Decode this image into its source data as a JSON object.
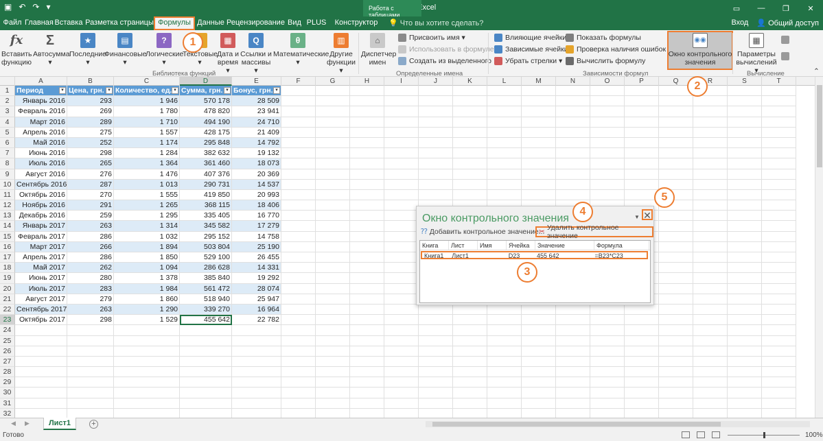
{
  "window": {
    "title": "Книга1 - Excel",
    "context_tab": "Работа с таблицами",
    "tell_me": "Что вы хотите сделать?",
    "signin": "Вход",
    "share": "Общий доступ"
  },
  "tabs": [
    "Файл",
    "Главная",
    "Вставка",
    "Разметка страницы",
    "Формулы",
    "Данные",
    "Рецензирование",
    "Вид",
    "PLUS",
    "Конструктор"
  ],
  "ribbon": {
    "insert_function": [
      "Вставить",
      "функцию"
    ],
    "buttons": [
      {
        "l1": "Автосумма",
        "l2": "▾"
      },
      {
        "l1": "Последние",
        "l2": "▾"
      },
      {
        "l1": "Финансовые",
        "l2": "▾"
      },
      {
        "l1": "Логические",
        "l2": "▾"
      },
      {
        "l1": "Текстовые",
        "l2": "▾"
      },
      {
        "l1": "Дата и",
        "l2": "время ▾"
      },
      {
        "l1": "Ссылки и",
        "l2": "массивы ▾"
      },
      {
        "l1": "Математические",
        "l2": "▾"
      },
      {
        "l1": "Другие",
        "l2": "функции ▾"
      }
    ],
    "group_library": "Библиотека функций",
    "name_manager": [
      "Диспетчер",
      "имен"
    ],
    "define_name": "Присвоить имя  ▾",
    "use_in_formula": "Использовать в формуле ▾",
    "create_from_selection": "Создать из выделенного",
    "group_names": "Определенные имена",
    "trace_precedents": "Влияющие ячейки",
    "trace_dependents": "Зависимые ячейки",
    "remove_arrows": "Убрать стрелки  ▾",
    "show_formulas": "Показать формулы",
    "error_checking": "Проверка наличия ошибок  ▾",
    "evaluate_formula": "Вычислить формулу",
    "watch_window": [
      "Окно контрольного",
      "значения"
    ],
    "group_audit": "Зависимости формул",
    "calc_options": [
      "Параметры",
      "вычислений ▾"
    ],
    "group_calc": "Вычисление"
  },
  "columns": [
    "A",
    "B",
    "C",
    "D",
    "E",
    "F",
    "G",
    "H",
    "I",
    "J",
    "K",
    "L",
    "M",
    "N",
    "O",
    "P",
    "Q",
    "R",
    "S",
    "T"
  ],
  "table": {
    "headers": [
      "Период",
      "Цена, грн.",
      "Количество, ед.",
      "Сумма, грн.",
      "Бонус, грн."
    ],
    "rows": [
      [
        "Январь 2016",
        "293",
        "1 946",
        "570 178",
        "28 509"
      ],
      [
        "Февраль 2016",
        "269",
        "1 780",
        "478 820",
        "23 941"
      ],
      [
        "Март 2016",
        "289",
        "1 710",
        "494 190",
        "24 710"
      ],
      [
        "Апрель 2016",
        "275",
        "1 557",
        "428 175",
        "21 409"
      ],
      [
        "Май 2016",
        "252",
        "1 174",
        "295 848",
        "14 792"
      ],
      [
        "Июнь 2016",
        "298",
        "1 284",
        "382 632",
        "19 132"
      ],
      [
        "Июль 2016",
        "265",
        "1 364",
        "361 460",
        "18 073"
      ],
      [
        "Август 2016",
        "276",
        "1 476",
        "407 376",
        "20 369"
      ],
      [
        "Сентябрь 2016",
        "287",
        "1 013",
        "290 731",
        "14 537"
      ],
      [
        "Октябрь 2016",
        "270",
        "1 555",
        "419 850",
        "20 993"
      ],
      [
        "Ноябрь 2016",
        "291",
        "1 265",
        "368 115",
        "18 406"
      ],
      [
        "Декабрь 2016",
        "259",
        "1 295",
        "335 405",
        "16 770"
      ],
      [
        "Январь 2017",
        "263",
        "1 314",
        "345 582",
        "17 279"
      ],
      [
        "Февраль 2017",
        "286",
        "1 032",
        "295 152",
        "14 758"
      ],
      [
        "Март 2017",
        "266",
        "1 894",
        "503 804",
        "25 190"
      ],
      [
        "Апрель 2017",
        "286",
        "1 850",
        "529 100",
        "26 455"
      ],
      [
        "Май 2017",
        "262",
        "1 094",
        "286 628",
        "14 331"
      ],
      [
        "Июнь 2017",
        "280",
        "1 378",
        "385 840",
        "19 292"
      ],
      [
        "Июль 2017",
        "283",
        "1 984",
        "561 472",
        "28 074"
      ],
      [
        "Август 2017",
        "279",
        "1 860",
        "518 940",
        "25 947"
      ],
      [
        "Сентябрь 2017",
        "263",
        "1 290",
        "339 270",
        "16 964"
      ],
      [
        "Октябрь 2017",
        "298",
        "1 529",
        "455 642",
        "22 782"
      ]
    ],
    "empty_rows": 9
  },
  "sheet": {
    "tab": "Лист1"
  },
  "status": {
    "ready": "Готово",
    "zoom": "100%"
  },
  "watch": {
    "title": "Окно контрольного значения",
    "add": "Добавить контрольное значение...",
    "delete": "Удалить контрольное значение",
    "cols": [
      "Книга",
      "Лист",
      "Имя",
      "Ячейка",
      "Значение",
      "Формула"
    ],
    "row": [
      "Книга1",
      "Лист1",
      "",
      "D23",
      "455 642",
      "=B23*C23"
    ]
  },
  "callouts": [
    "1",
    "2",
    "3",
    "4",
    "5"
  ],
  "colors": {
    "excel_green": "#217346",
    "accent": "#ed7d31",
    "table_header": "#5b9bd5",
    "band": "#ddebf7"
  }
}
